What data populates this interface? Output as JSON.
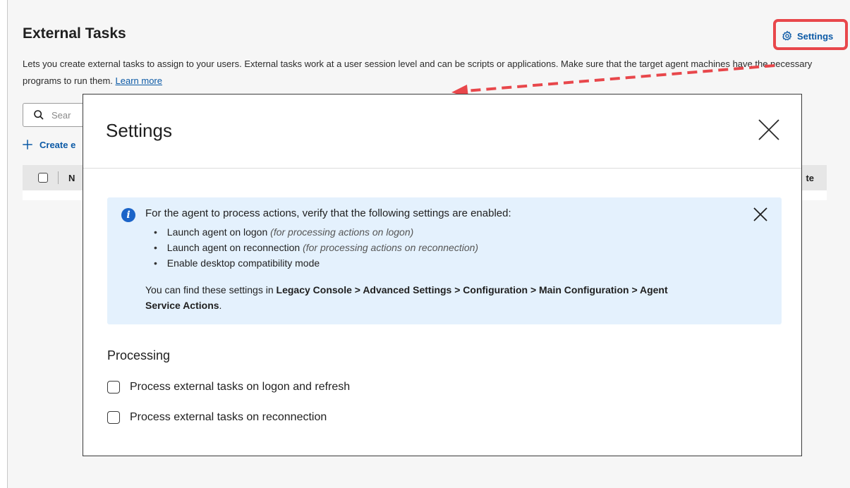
{
  "page": {
    "title": "External Tasks",
    "description": "Lets you create external tasks to assign to your users. External tasks work at a user session level and can be scripts or applications. Make sure that the target agent machines have the necessary programs to run them.",
    "learn_more": "Learn more",
    "settings_label": "Settings",
    "search_placeholder": "Sear",
    "create_label": "Create e",
    "table_col_name": "N",
    "table_col_right": "te"
  },
  "modal": {
    "title": "Settings",
    "alert": {
      "intro": "For the agent to process actions, verify that the following settings are enabled:",
      "items": [
        {
          "label": "Launch agent on logon",
          "note": "(for processing actions on logon)"
        },
        {
          "label": "Launch agent on reconnection",
          "note": "(for processing actions on reconnection)"
        },
        {
          "label": "Enable desktop compatibility mode",
          "note": ""
        }
      ],
      "path_prefix": "You can find these settings in",
      "path_bold": "Legacy Console > Advanced Settings > Configuration > Main Configuration > Agent Service Actions",
      "path_suffix": "."
    },
    "section_title": "Processing",
    "checkboxes": [
      {
        "label": "Process external tasks on logon and refresh",
        "checked": false
      },
      {
        "label": "Process external tasks on reconnection",
        "checked": false
      }
    ]
  },
  "colors": {
    "accent": "#0c5aa6",
    "annotation": "#e8474b",
    "info_bg": "#e4f1fd",
    "info_icon": "#1b64c8"
  },
  "icons": [
    "gear-icon",
    "search-icon",
    "plus-icon",
    "close-icon",
    "info-icon"
  ]
}
